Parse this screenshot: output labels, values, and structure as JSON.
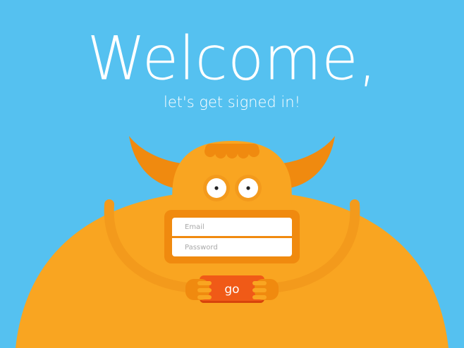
{
  "header": {
    "title": "Welcome,",
    "subtitle": "let's get signed in!"
  },
  "form": {
    "email_placeholder": "Email",
    "password_placeholder": "Password",
    "submit_label": "go"
  },
  "colors": {
    "background": "#55c1f0",
    "monster_body": "#f9a521",
    "monster_horn": "#f08a0f",
    "button": "#f05a17",
    "text": "#ffffff"
  }
}
